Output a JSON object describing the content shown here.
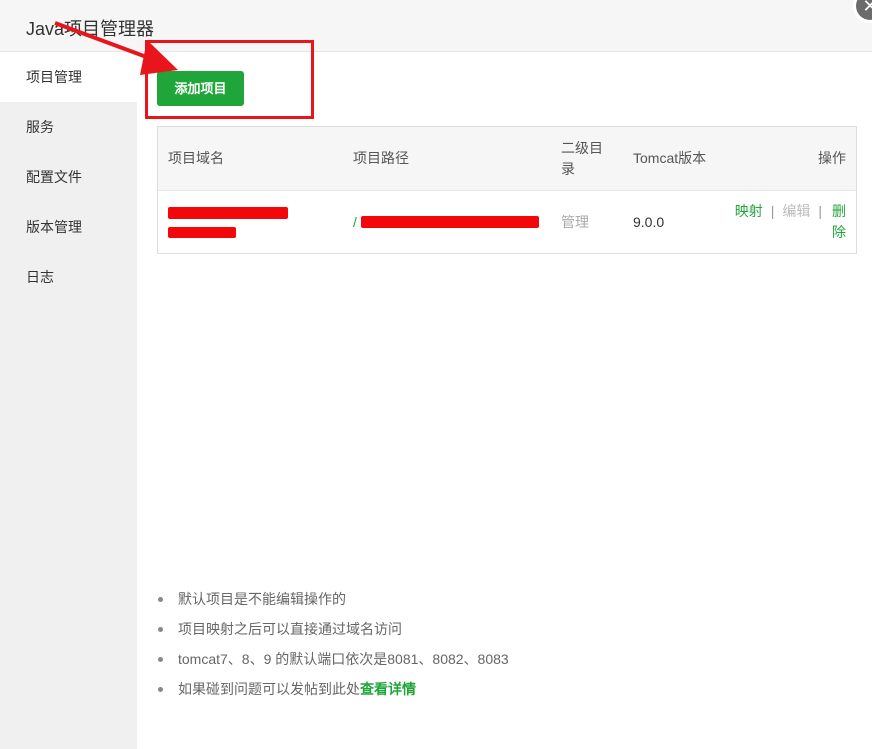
{
  "window": {
    "title": "Java项目管理器",
    "close_glyph": "✕"
  },
  "sidebar": {
    "items": [
      {
        "label": "项目管理",
        "active": true
      },
      {
        "label": "服务",
        "active": false
      },
      {
        "label": "配置文件",
        "active": false
      },
      {
        "label": "版本管理",
        "active": false
      },
      {
        "label": "日志",
        "active": false
      }
    ]
  },
  "toolbar": {
    "add_label": "添加项目"
  },
  "table": {
    "headers": {
      "domain": "项目域名",
      "path": "项目路径",
      "subdir": "二级目录",
      "tomcat": "Tomcat版本",
      "ops": "操作"
    },
    "rows": [
      {
        "domain": "(redacted)",
        "path_prefix": "/",
        "subdir": "管理",
        "tomcat": "9.0.0",
        "op_map": "映射",
        "op_edit": "编辑",
        "op_delete": "删除",
        "separator": "|"
      }
    ]
  },
  "notes": [
    "默认项目是不能编辑操作的",
    "项目映射之后可以直接通过域名访问",
    "tomcat7、8、9 的默认端口依次是8081、8082、8083"
  ],
  "note_last": {
    "text": "如果碰到问题可以发帖到此处",
    "link": "查看详情"
  },
  "colors": {
    "accent": "#20a53a",
    "annotation": "#e8161c",
    "sidebar_bg": "#f0f0f0"
  }
}
